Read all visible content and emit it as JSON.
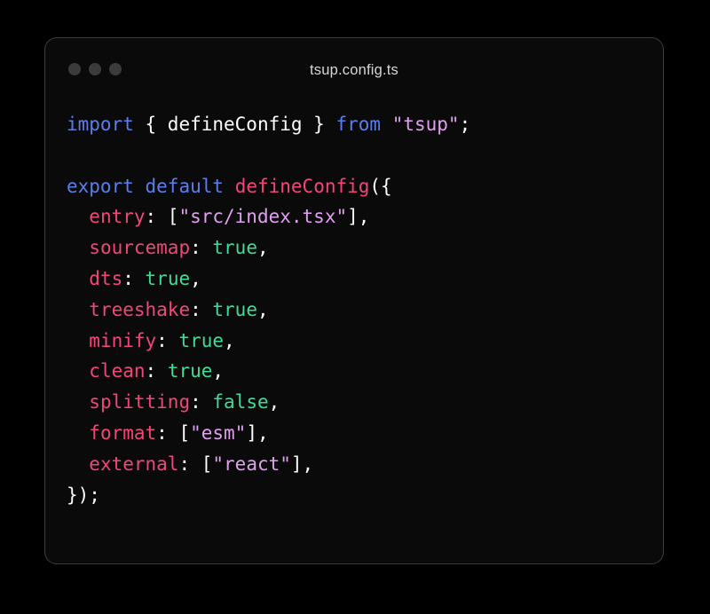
{
  "window": {
    "title": "tsup.config.ts",
    "controls": [
      {
        "name": "close-dot",
        "color": "#3b3b3b"
      },
      {
        "name": "minimize-dot",
        "color": "#3b3b3b"
      },
      {
        "name": "maximize-dot",
        "color": "#3b3b3b"
      }
    ],
    "background": "#0a0a0a",
    "border_color": "#3c3c3c"
  },
  "theme": {
    "page_background": "#000000",
    "keyword": "#5a7fec",
    "function": "#f2457a",
    "property": "#f2457a",
    "string": "#e0a0ef",
    "boolean": "#3ddc9a",
    "plain": "#ffffff",
    "title_text": "#d6d6d6"
  },
  "code": {
    "language": "typescript",
    "filename": "tsup.config.ts",
    "plain_text": "import { defineConfig } from \"tsup\";\n\nexport default defineConfig({\n  entry: [\"src/index.tsx\"],\n  sourcemap: true,\n  dts: true,\n  treeshake: true,\n  minify: true,\n  clean: true,\n  splitting: false,\n  format: [\"esm\"],\n  external: [\"react\"],\n});",
    "lines": [
      {
        "id": "line-1",
        "tokens": [
          {
            "t": "import",
            "c": "keyword"
          },
          {
            "t": " ",
            "c": "plain"
          },
          {
            "t": "{ defineConfig }",
            "c": "plain"
          },
          {
            "t": " ",
            "c": "plain"
          },
          {
            "t": "from",
            "c": "keyword"
          },
          {
            "t": " ",
            "c": "plain"
          },
          {
            "t": "\"tsup\"",
            "c": "string"
          },
          {
            "t": ";",
            "c": "punct"
          }
        ]
      },
      {
        "id": "line-2",
        "tokens": []
      },
      {
        "id": "line-3",
        "tokens": [
          {
            "t": "export",
            "c": "keyword"
          },
          {
            "t": " ",
            "c": "plain"
          },
          {
            "t": "default",
            "c": "keyword"
          },
          {
            "t": " ",
            "c": "plain"
          },
          {
            "t": "defineConfig",
            "c": "function"
          },
          {
            "t": "({",
            "c": "punct"
          }
        ]
      },
      {
        "id": "line-4",
        "tokens": [
          {
            "t": "  ",
            "c": "plain"
          },
          {
            "t": "entry",
            "c": "property"
          },
          {
            "t": ": [",
            "c": "punct"
          },
          {
            "t": "\"src/index.tsx\"",
            "c": "string"
          },
          {
            "t": "],",
            "c": "punct"
          }
        ]
      },
      {
        "id": "line-5",
        "tokens": [
          {
            "t": "  ",
            "c": "plain"
          },
          {
            "t": "sourcemap",
            "c": "property"
          },
          {
            "t": ": ",
            "c": "punct"
          },
          {
            "t": "true",
            "c": "boolean"
          },
          {
            "t": ",",
            "c": "punct"
          }
        ]
      },
      {
        "id": "line-6",
        "tokens": [
          {
            "t": "  ",
            "c": "plain"
          },
          {
            "t": "dts",
            "c": "property"
          },
          {
            "t": ": ",
            "c": "punct"
          },
          {
            "t": "true",
            "c": "boolean"
          },
          {
            "t": ",",
            "c": "punct"
          }
        ]
      },
      {
        "id": "line-7",
        "tokens": [
          {
            "t": "  ",
            "c": "plain"
          },
          {
            "t": "treeshake",
            "c": "property"
          },
          {
            "t": ": ",
            "c": "punct"
          },
          {
            "t": "true",
            "c": "boolean"
          },
          {
            "t": ",",
            "c": "punct"
          }
        ]
      },
      {
        "id": "line-8",
        "tokens": [
          {
            "t": "  ",
            "c": "plain"
          },
          {
            "t": "minify",
            "c": "property"
          },
          {
            "t": ": ",
            "c": "punct"
          },
          {
            "t": "true",
            "c": "boolean"
          },
          {
            "t": ",",
            "c": "punct"
          }
        ]
      },
      {
        "id": "line-9",
        "tokens": [
          {
            "t": "  ",
            "c": "plain"
          },
          {
            "t": "clean",
            "c": "property"
          },
          {
            "t": ": ",
            "c": "punct"
          },
          {
            "t": "true",
            "c": "boolean"
          },
          {
            "t": ",",
            "c": "punct"
          }
        ]
      },
      {
        "id": "line-10",
        "tokens": [
          {
            "t": "  ",
            "c": "plain"
          },
          {
            "t": "splitting",
            "c": "property"
          },
          {
            "t": ": ",
            "c": "punct"
          },
          {
            "t": "false",
            "c": "boolean"
          },
          {
            "t": ",",
            "c": "punct"
          }
        ]
      },
      {
        "id": "line-11",
        "tokens": [
          {
            "t": "  ",
            "c": "plain"
          },
          {
            "t": "format",
            "c": "property"
          },
          {
            "t": ": [",
            "c": "punct"
          },
          {
            "t": "\"esm\"",
            "c": "string"
          },
          {
            "t": "],",
            "c": "punct"
          }
        ]
      },
      {
        "id": "line-12",
        "tokens": [
          {
            "t": "  ",
            "c": "plain"
          },
          {
            "t": "external",
            "c": "property"
          },
          {
            "t": ": [",
            "c": "punct"
          },
          {
            "t": "\"react\"",
            "c": "string"
          },
          {
            "t": "],",
            "c": "punct"
          }
        ]
      },
      {
        "id": "line-13",
        "tokens": [
          {
            "t": "});",
            "c": "punct"
          }
        ]
      }
    ]
  }
}
